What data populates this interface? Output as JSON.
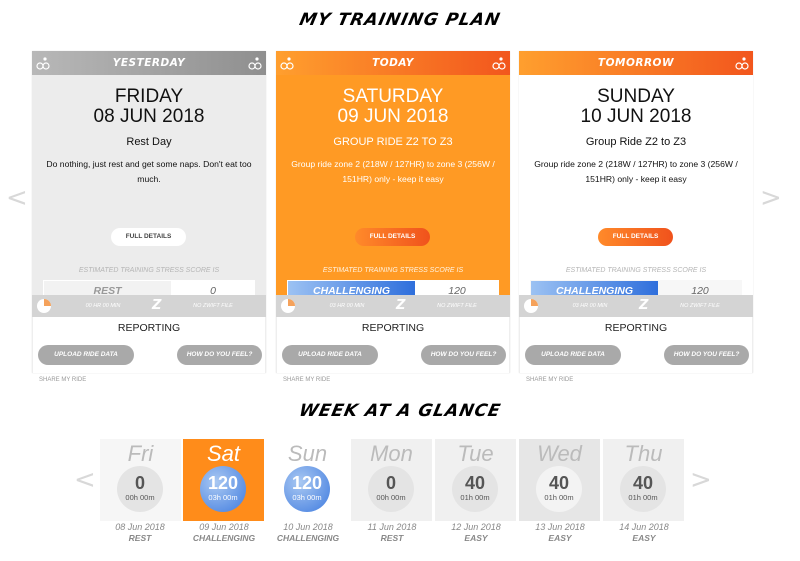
{
  "titles": {
    "plan": "MY TRAINING PLAN",
    "glance": "WEEK AT A GLANCE"
  },
  "nav": {
    "prev": "<",
    "next": ">"
  },
  "cards": [
    {
      "header": "YESTERDAY",
      "day": "FRIDAY",
      "date": "08 JUN 2018",
      "ride": "Rest Day",
      "description": "Do nothing, just rest and get some naps. Don't eat too much.",
      "full_details": "FULL DETAILS",
      "tss_label": "ESTIMATED TRAINING STRESS SCORE IS",
      "tss_level": "REST",
      "tss_value": "0",
      "duration": "00 HR 00 MIN",
      "zwift": "NO ZWIFT FILE",
      "reporting": "REPORTING",
      "upload": "UPLOAD RIDE DATA",
      "feel": "HOW DO YOU FEEL?",
      "share": "SHARE MY RIDE"
    },
    {
      "header": "TODAY",
      "day": "SATURDAY",
      "date": "09 JUN 2018",
      "ride": "GROUP RIDE Z2 TO Z3",
      "description": "Group ride zone 2 (218W / 127HR) to zone 3 (256W / 151HR) only - keep it easy",
      "full_details": "FULL DETAILS",
      "tss_label": "ESTIMATED TRAINING STRESS SCORE IS",
      "tss_level": "CHALLENGING",
      "tss_value": "120",
      "duration": "03 HR 00 MIN",
      "zwift": "NO ZWIFT FILE",
      "reporting": "REPORTING",
      "upload": "UPLOAD RIDE DATA",
      "feel": "HOW DO YOU FEEL?",
      "share": "SHARE MY RIDE"
    },
    {
      "header": "TOMORROW",
      "day": "SUNDAY",
      "date": "10 JUN 2018",
      "ride": "Group Ride Z2 to Z3",
      "description": "Group ride zone 2 (218W / 127HR) to zone 3 (256W / 151HR) only - keep it easy",
      "full_details": "FULL DETAILS",
      "tss_label": "ESTIMATED TRAINING STRESS SCORE IS",
      "tss_level": "CHALLENGING",
      "tss_value": "120",
      "duration": "03 HR 00 MIN",
      "zwift": "NO ZWIFT FILE",
      "reporting": "REPORTING",
      "upload": "UPLOAD RIDE DATA",
      "feel": "HOW DO YOU FEEL?",
      "share": "SHARE MY RIDE"
    }
  ],
  "week": [
    {
      "day": "Fri",
      "tss": "0",
      "time": "00h 00m",
      "date": "08 Jun 2018",
      "level": "REST"
    },
    {
      "day": "Sat",
      "tss": "120",
      "time": "03h 00m",
      "date": "09 Jun 2018",
      "level": "CHALLENGING"
    },
    {
      "day": "Sun",
      "tss": "120",
      "time": "03h 00m",
      "date": "10 Jun 2018",
      "level": "CHALLENGING"
    },
    {
      "day": "Mon",
      "tss": "0",
      "time": "00h 00m",
      "date": "11 Jun 2018",
      "level": "REST"
    },
    {
      "day": "Tue",
      "tss": "40",
      "time": "01h 00m",
      "date": "12 Jun 2018",
      "level": "EASY"
    },
    {
      "day": "Wed",
      "tss": "40",
      "time": "01h 00m",
      "date": "13 Jun 2018",
      "level": "EASY"
    },
    {
      "day": "Thu",
      "tss": "40",
      "time": "01h 00m",
      "date": "14 Jun 2018",
      "level": "EASY"
    }
  ],
  "colors": {
    "orange": "#ff8c1a",
    "orange_dark": "#f25a1e",
    "blue": "#2f6fdc",
    "grey_header": "#a0a0a0",
    "grey_card": "#ececec"
  },
  "icons": {
    "cyclist": "cyclist-logo-icon",
    "clock": "clock-pie-icon",
    "zwift": "zwift-z-icon"
  }
}
